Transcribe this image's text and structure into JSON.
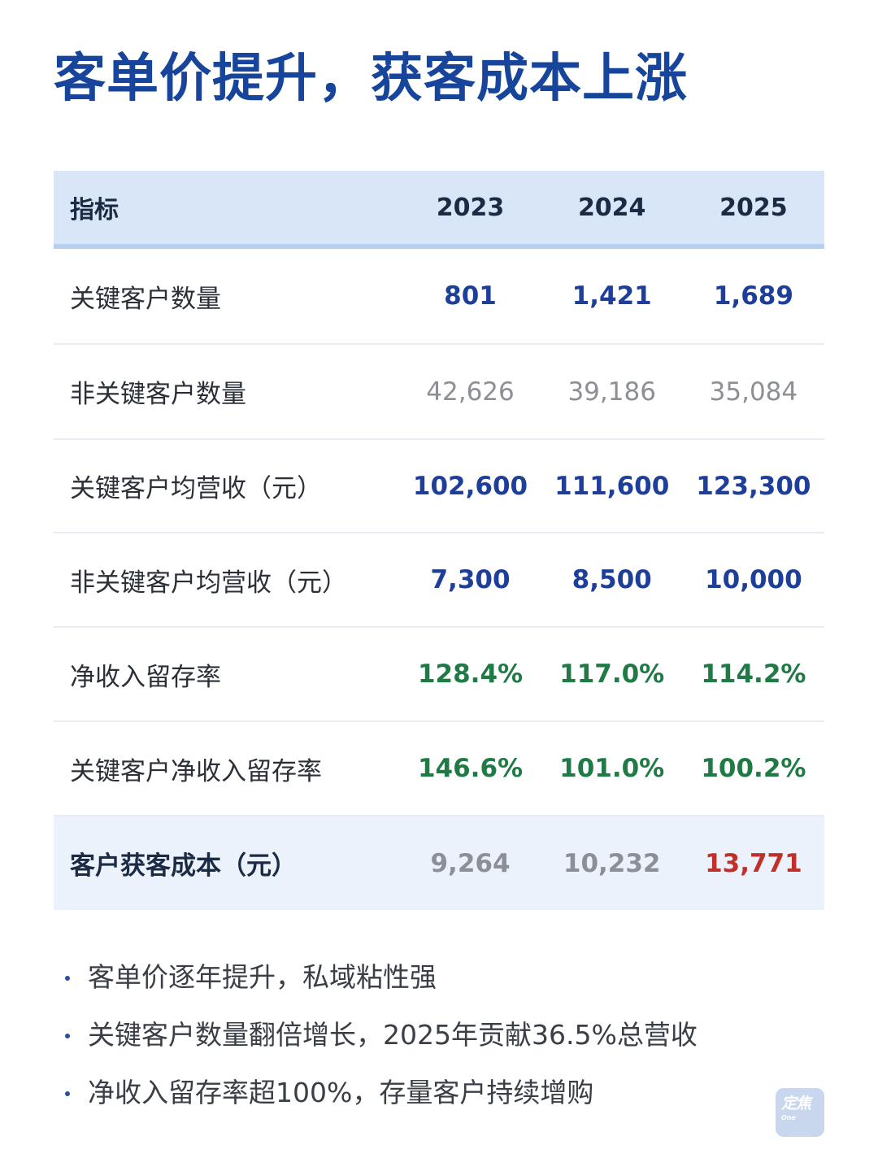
{
  "title": "客单价提升，获客成本上涨",
  "table": {
    "header": {
      "label": "指标",
      "years": [
        "2023",
        "2024",
        "2025"
      ]
    },
    "rows": [
      {
        "label": "关键客户数量",
        "values": [
          "801",
          "1,421",
          "1,689"
        ]
      },
      {
        "label": "非关键客户数量",
        "values": [
          "42,626",
          "39,186",
          "35,084"
        ]
      },
      {
        "label": "关键客户均营收（元）",
        "values": [
          "102,600",
          "111,600",
          "123,300"
        ]
      },
      {
        "label": "非关键客户均营收（元）",
        "values": [
          "7,300",
          "8,500",
          "10,000"
        ]
      },
      {
        "label": "净收入留存率",
        "values": [
          "128.4%",
          "117.0%",
          "114.2%"
        ]
      },
      {
        "label": "关键客户净收入留存率",
        "values": [
          "146.6%",
          "101.0%",
          "100.2%"
        ]
      },
      {
        "label": "客户获客成本（元）",
        "values": [
          "9,264",
          "10,232",
          "13,771"
        ]
      }
    ]
  },
  "bullets": [
    "客单价逐年提升，私域粘性强",
    "关键客户数量翻倍增长，2025年贡献36.5%总营收",
    "净收入留存率超100%，存量客户持续增购"
  ],
  "logo": {
    "main": "定焦",
    "sub": "One"
  },
  "colors": {
    "title": "#17459b",
    "header_bg": "#d8e6f7",
    "value_blue": "#1d3f9a",
    "value_green": "#1f7a45",
    "value_gray": "#8c8f95",
    "value_red": "#c0302a",
    "highlight_row_bg": "#ebf2fc"
  }
}
